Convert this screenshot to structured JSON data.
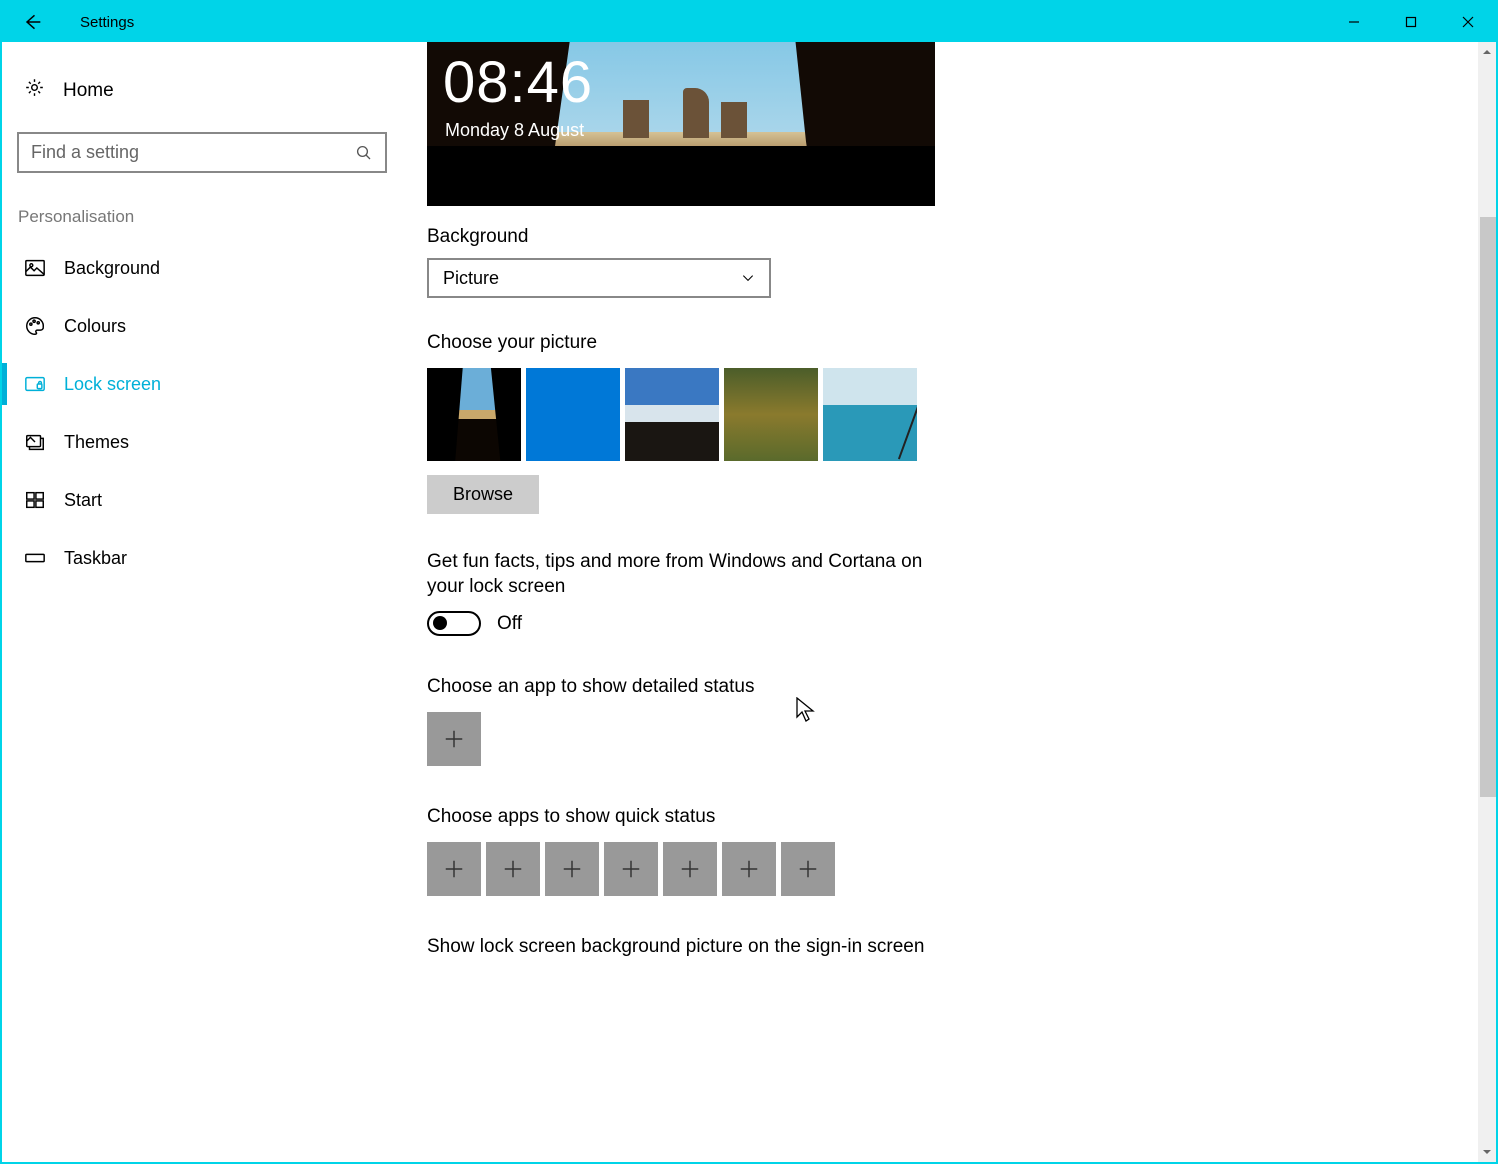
{
  "window": {
    "title": "Settings"
  },
  "sidebar": {
    "home": "Home",
    "searchPlaceholder": "Find a setting",
    "category": "Personalisation",
    "items": [
      {
        "label": "Background"
      },
      {
        "label": "Colours"
      },
      {
        "label": "Lock screen"
      },
      {
        "label": "Themes"
      },
      {
        "label": "Start"
      },
      {
        "label": "Taskbar"
      }
    ]
  },
  "preview": {
    "time": "08:46",
    "date": "Monday 8 August"
  },
  "background": {
    "label": "Background",
    "comboValue": "Picture"
  },
  "choosePicture": {
    "label": "Choose your picture",
    "browse": "Browse"
  },
  "funFacts": {
    "text": "Get fun facts, tips and more from Windows and Cortana on your lock screen",
    "state": "Off"
  },
  "detailedStatus": {
    "label": "Choose an app to show detailed status"
  },
  "quickStatus": {
    "label": "Choose apps to show quick status",
    "slotCount": 7
  },
  "signin": {
    "label": "Show lock screen background picture on the sign-in screen"
  }
}
